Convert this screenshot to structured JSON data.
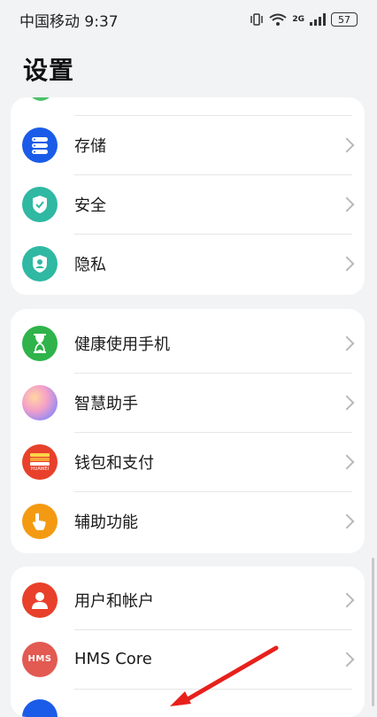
{
  "status_bar": {
    "carrier_time": "中国移动 9:37",
    "network": "2G",
    "battery": "57"
  },
  "page": {
    "title": "设置"
  },
  "groups": [
    {
      "items": [
        {
          "label": "存储",
          "icon": "storage-icon",
          "color": "#1a5ce8"
        },
        {
          "label": "安全",
          "icon": "shield-icon",
          "color": "#2fb8a2"
        },
        {
          "label": "隐私",
          "icon": "privacy-icon",
          "color": "#2fb8a2"
        }
      ]
    },
    {
      "items": [
        {
          "label": "健康使用手机",
          "icon": "hourglass-icon",
          "color": "#2fb34a"
        },
        {
          "label": "智慧助手",
          "icon": "assistant-orb-icon",
          "color": "#e8a0d0"
        },
        {
          "label": "钱包和支付",
          "icon": "wallet-icon",
          "color": "#e8402b",
          "icon_text": "HUAWEI"
        },
        {
          "label": "辅助功能",
          "icon": "hand-pointer-icon",
          "color": "#f49a12"
        }
      ]
    },
    {
      "items": [
        {
          "label": "用户和帐户",
          "icon": "user-icon",
          "color": "#e8402b"
        },
        {
          "label": "HMS Core",
          "icon": "hms-icon",
          "color": "#e25a52",
          "icon_text": "HMS"
        }
      ]
    }
  ]
}
